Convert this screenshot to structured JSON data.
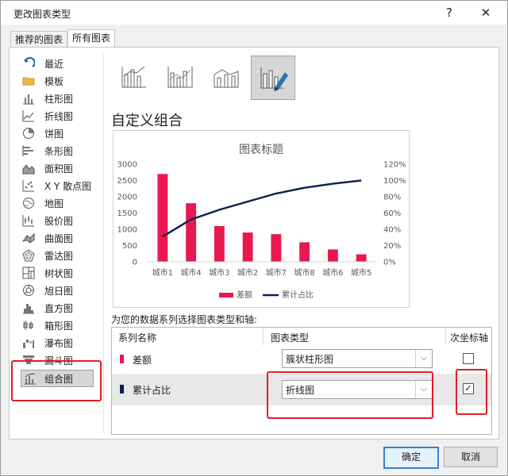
{
  "dialog": {
    "title": "更改图表类型",
    "help_glyph": "?",
    "close_glyph": "✕"
  },
  "tabs": [
    {
      "label": "推荐的图表"
    },
    {
      "label": "所有图表"
    }
  ],
  "sidebar": {
    "items": [
      {
        "label": "最近",
        "icon": "recent-arrow-icon"
      },
      {
        "label": "模板",
        "icon": "folder-icon"
      },
      {
        "label": "柱形图",
        "icon": "column-chart-icon"
      },
      {
        "label": "折线图",
        "icon": "line-chart-icon"
      },
      {
        "label": "饼图",
        "icon": "pie-chart-icon"
      },
      {
        "label": "条形图",
        "icon": "bar-chart-icon"
      },
      {
        "label": "面积图",
        "icon": "area-chart-icon"
      },
      {
        "label": "X Y 散点图",
        "icon": "scatter-chart-icon"
      },
      {
        "label": "地图",
        "icon": "map-chart-icon"
      },
      {
        "label": "股价图",
        "icon": "stock-chart-icon"
      },
      {
        "label": "曲面图",
        "icon": "surface-chart-icon"
      },
      {
        "label": "雷达图",
        "icon": "radar-chart-icon"
      },
      {
        "label": "树状图",
        "icon": "treemap-chart-icon"
      },
      {
        "label": "旭日图",
        "icon": "sunburst-chart-icon"
      },
      {
        "label": "直方图",
        "icon": "histogram-chart-icon"
      },
      {
        "label": "箱形图",
        "icon": "box-whisker-chart-icon"
      },
      {
        "label": "瀑布图",
        "icon": "waterfall-chart-icon"
      },
      {
        "label": "漏斗图",
        "icon": "funnel-chart-icon"
      },
      {
        "label": "组合图",
        "icon": "combo-chart-icon",
        "selected": true
      }
    ]
  },
  "subtypes": [
    {
      "name": "clustered-column-line-icon"
    },
    {
      "name": "clustered-column-line-secondary-icon"
    },
    {
      "name": "stacked-area-column-icon"
    },
    {
      "name": "custom-combination-icon",
      "selected": true
    }
  ],
  "section_heading": "自定义组合",
  "chart_data": {
    "type": "bar",
    "title": "图表标题",
    "categories": [
      "城市1",
      "城市4",
      "城市3",
      "城市2",
      "城市7",
      "城市8",
      "城市6",
      "城市5"
    ],
    "series": [
      {
        "name": "差额",
        "type": "bar",
        "axis": "primary",
        "color": "#e8194f",
        "values": [
          2700,
          1800,
          1100,
          900,
          850,
          600,
          380,
          230
        ]
      },
      {
        "name": "累计占比",
        "type": "line",
        "axis": "secondary",
        "color": "#0d1f4e",
        "values": [
          0.31,
          0.52,
          0.64,
          0.74,
          0.84,
          0.91,
          0.96,
          1.0
        ]
      }
    ],
    "ylim": [
      0,
      3000
    ],
    "yticks": [
      "3000",
      "2500",
      "2000",
      "1500",
      "1000",
      "500",
      "0"
    ],
    "y2lim": [
      0,
      1.2
    ],
    "y2ticks": [
      "120%",
      "100%",
      "80%",
      "60%",
      "40%",
      "20%",
      "0%"
    ],
    "legend": "bottom",
    "grid": false
  },
  "series_config": {
    "prompt": "为您的数据系列选择图表类型和轴:",
    "headers": {
      "name": "系列名称",
      "type": "图表类型",
      "secondary": "次坐标轴"
    },
    "rows": [
      {
        "name": "差额",
        "color": "#e8194f",
        "chart_type": "簇状柱形图",
        "secondary_axis": false
      },
      {
        "name": "累计占比",
        "color": "#0d1f4e",
        "chart_type": "折线图",
        "secondary_axis": true
      }
    ]
  },
  "buttons": {
    "ok": "确定",
    "cancel": "取消"
  },
  "colors": {
    "highlight": "#e41e26",
    "primary_button_border": "#3c7fd1"
  }
}
